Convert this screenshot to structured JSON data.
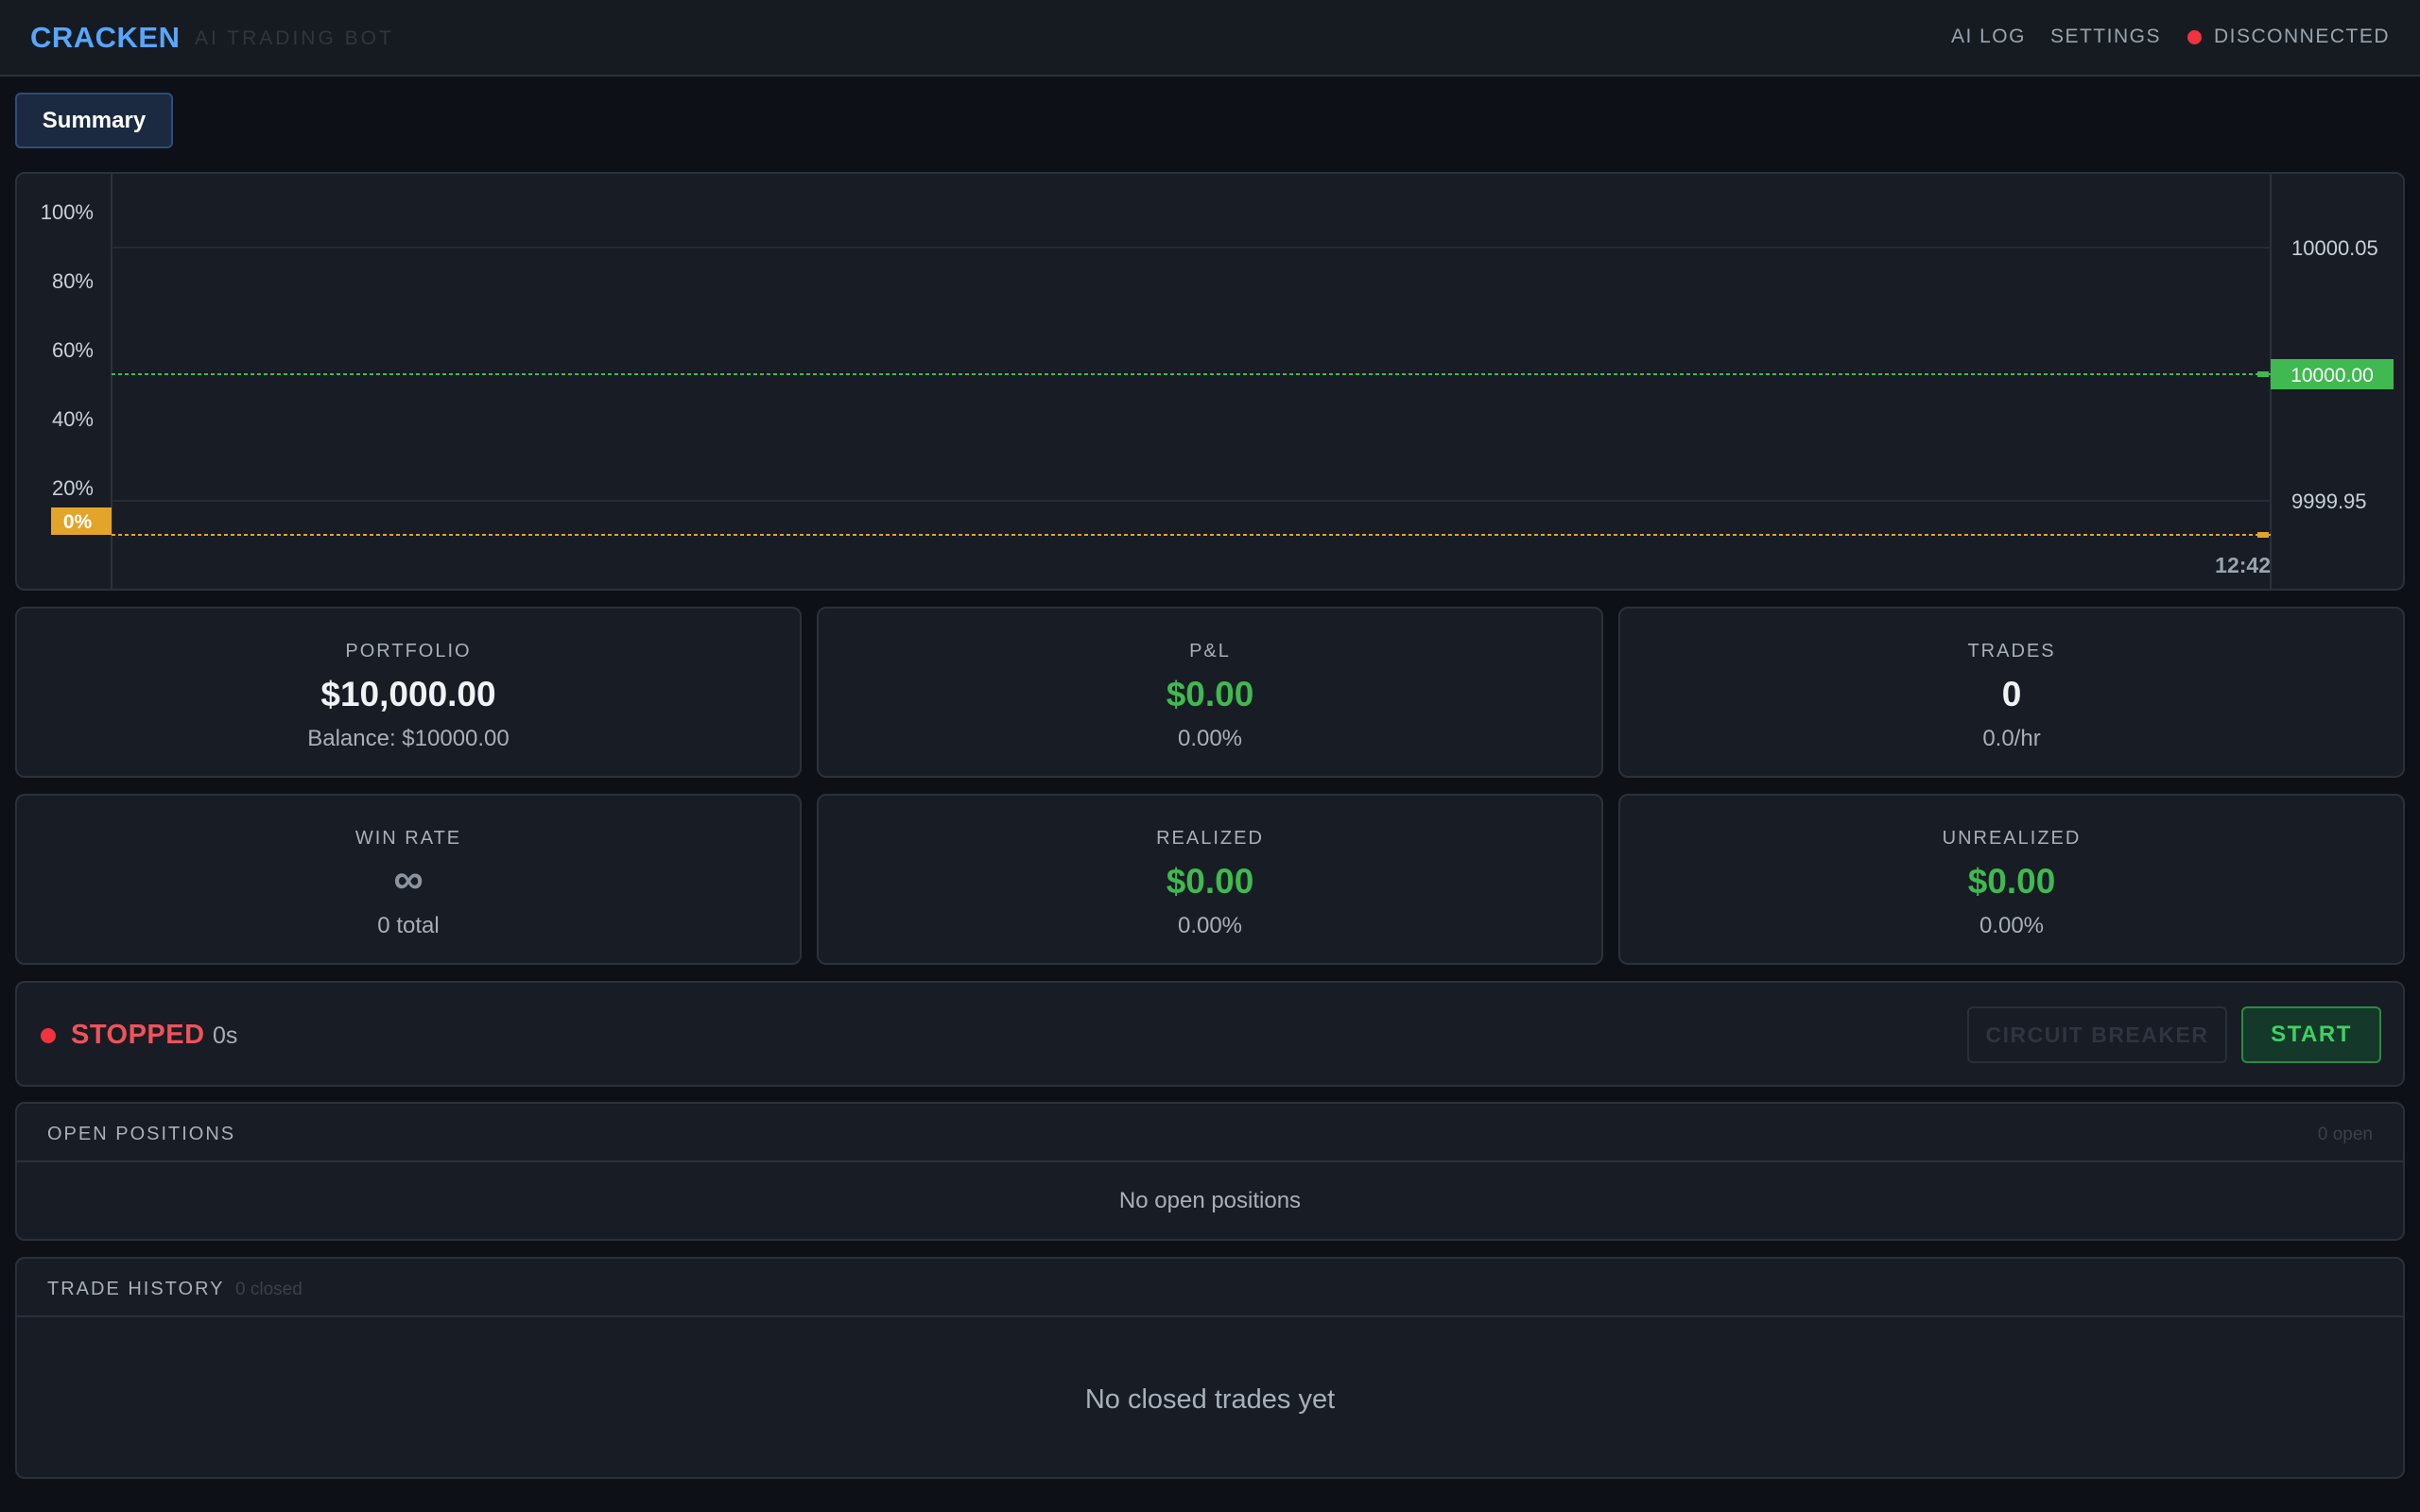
{
  "header": {
    "brand": "CRACKEN",
    "subtitle": "AI TRADING BOT",
    "nav": {
      "ai_log": "AI LOG",
      "settings": "SETTINGS"
    },
    "connection_status": "DISCONNECTED",
    "connection_color": "#f0333f"
  },
  "tabs": {
    "summary": "Summary"
  },
  "chart_data": {
    "type": "line",
    "left_axis": {
      "ticks": [
        "100%",
        "80%",
        "60%",
        "40%",
        "20%"
      ],
      "ylim": [
        0,
        100
      ],
      "current_tag": "0%",
      "current_value": 0,
      "color": "#e3a42a"
    },
    "right_axis": {
      "ticks": [
        "10000.05",
        "9999.95"
      ],
      "ylim": [
        9999.95,
        10000.05
      ],
      "current_tag": "10000.00",
      "current_value": 10000.0,
      "color": "#3fb950"
    },
    "x_ticks": [
      "12:42"
    ],
    "series": [
      {
        "axis": "right",
        "values": [
          10000.0
        ],
        "color": "#3fb950"
      },
      {
        "axis": "left",
        "values": [
          0
        ],
        "color": "#e3a42a"
      }
    ],
    "grid": true
  },
  "stats": {
    "portfolio": {
      "label": "PORTFOLIO",
      "value": "$10,000.00",
      "sub": "Balance: $10000.00"
    },
    "pnl": {
      "label": "P&L",
      "value": "$0.00",
      "sub": "0.00%"
    },
    "trades": {
      "label": "TRADES",
      "value": "0",
      "sub": "0.0/hr"
    },
    "win_rate": {
      "label": "WIN RATE",
      "value": "∞",
      "sub": "0 total"
    },
    "realized": {
      "label": "REALIZED",
      "value": "$0.00",
      "sub": "0.00%"
    },
    "unrealized": {
      "label": "UNREALIZED",
      "value": "$0.00",
      "sub": "0.00%"
    }
  },
  "control": {
    "status": "STOPPED",
    "uptime": "0s",
    "circuit_breaker": "CIRCUIT BREAKER",
    "start": "START"
  },
  "open_positions": {
    "title": "OPEN POSITIONS",
    "count": "0 open",
    "empty": "No open positions"
  },
  "trade_history": {
    "title": "TRADE HISTORY",
    "count": "0 closed",
    "empty": "No closed trades yet"
  },
  "colors": {
    "accent": "#58a6ff",
    "positive": "#3fb950",
    "negative": "#f0525b",
    "warning": "#e3a42a"
  }
}
